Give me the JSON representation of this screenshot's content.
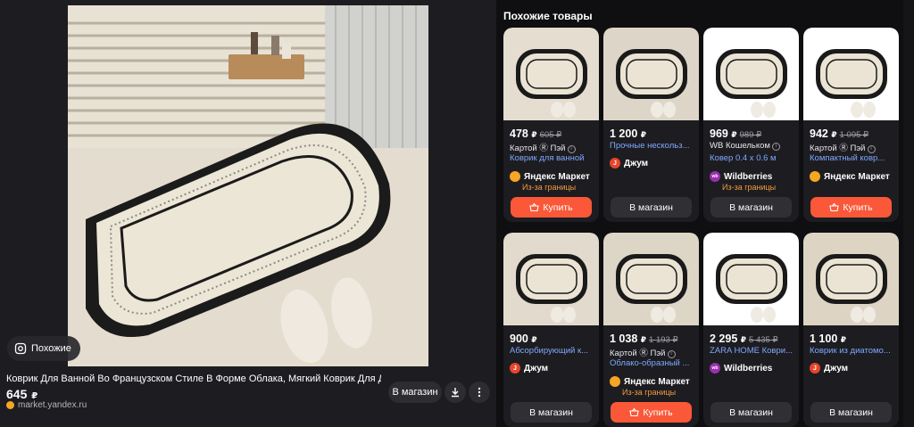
{
  "main": {
    "similar_chip": "Похожие",
    "title": "Коврик Для Ванной Во Французском Стиле В Форме Облака, Мягкий Коврик Для Двери Т",
    "price": "645",
    "currency": "₽",
    "source": "market.yandex.ru",
    "store_button": "В магазин",
    "download_icon": "download-icon",
    "more_icon": "more-vertical-icon"
  },
  "similar": {
    "title": "Похожие товары",
    "cards": [
      {
        "price": "478",
        "old_price": "605 ₽",
        "line2": "Картой Ⓡ Пэй",
        "line3": "Коврик для ванной",
        "shop": "Яндекс Маркет",
        "abroad": "Из-за границы",
        "button": "Купить"
      },
      {
        "price": "1 200",
        "old_price": "",
        "line2": "Прочные нескольз...",
        "line3": "",
        "shop": "Джум",
        "abroad": "",
        "button": "В магазин"
      },
      {
        "price": "969",
        "old_price": "989 ₽",
        "line2": "WB Кошельком",
        "line3": "Ковер 0.4 x 0.6 м",
        "shop": "Wildberries",
        "abroad": "Из-за границы",
        "button": "В магазин"
      },
      {
        "price": "942",
        "old_price": "1 095 ₽",
        "line2": "Картой Ⓡ Пэй",
        "line3": "Компактный ковр...",
        "shop": "Яндекс Маркет",
        "abroad": "",
        "button": "Купить"
      },
      {
        "price": "900",
        "old_price": "",
        "line2": "Абсорбирующий к...",
        "line3": "",
        "shop": "Джум",
        "abroad": "",
        "button": "В магазин"
      },
      {
        "price": "1 038",
        "old_price": "1 193 ₽",
        "line2": "Картой Ⓡ Пэй",
        "line3": "Облако-образный ...",
        "shop": "Яндекс Маркет",
        "abroad": "Из-за границы",
        "button": "Купить"
      },
      {
        "price": "2 295",
        "old_price": "5 435 ₽",
        "line2": "ZARA HOME Коври...",
        "line3": "",
        "shop": "Wildberries",
        "abroad": "",
        "button": "В магазин"
      },
      {
        "price": "1 100",
        "old_price": "",
        "line2": "Коврик из диатомо...",
        "line3": "",
        "shop": "Джум",
        "abroad": "",
        "button": "В магазин"
      }
    ]
  },
  "colors": {
    "accent_orange": "#fa5838",
    "link_blue": "#7fa8ff",
    "abroad_orange": "#f29a3d",
    "yandex": "#f5a623",
    "joom": "#e8452c",
    "wildberries": "#9b2fae"
  }
}
